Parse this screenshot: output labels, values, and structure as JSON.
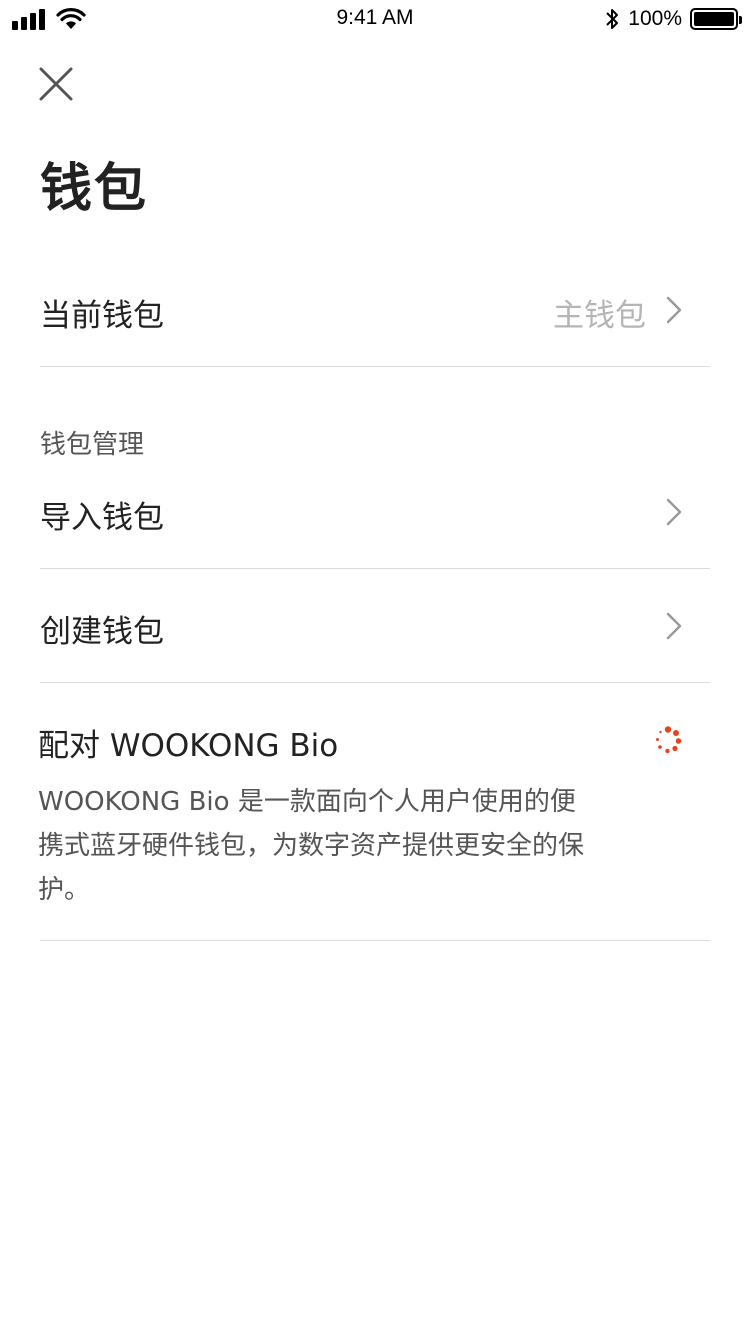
{
  "status_bar": {
    "time": "9:41 AM",
    "battery_percent": "100%",
    "battery_level": 1.0,
    "icons": [
      "signal-icon",
      "wifi-icon",
      "bluetooth-icon",
      "battery-icon"
    ]
  },
  "header": {
    "close_icon": "close-icon",
    "title": "钱包"
  },
  "current_wallet": {
    "label": "当前钱包",
    "value": "主钱包"
  },
  "wallet_management": {
    "section_title": "钱包管理",
    "items": [
      {
        "label": "导入钱包"
      },
      {
        "label": "创建钱包"
      }
    ]
  },
  "pair": {
    "title": "配对 WOOKONG Bio",
    "description": "WOOKONG Bio 是一款面向个人用户使用的便携式蓝牙硬件钱包，为数字资产提供更安全的保护。",
    "spinner_icon": "loading-spinner-icon"
  },
  "colors": {
    "accent": "#e8411c",
    "divider": "#dcdcdc",
    "muted_text": "#b5b5b5",
    "primary_text": "#222222"
  }
}
